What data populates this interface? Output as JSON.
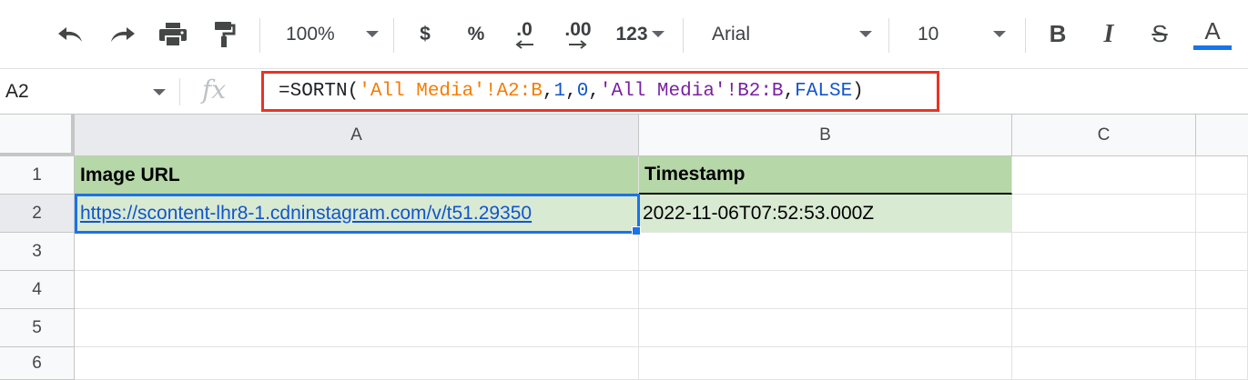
{
  "toolbar": {
    "zoom": "100%",
    "currency": "$",
    "percent": "%",
    "dec_decrease": ".0",
    "dec_increase": ".00",
    "more_formats": "123",
    "font": "Arial",
    "font_size": "10",
    "bold": "B",
    "italic": "I",
    "strike": "S",
    "text_color": "A",
    "text_color_swatch": "#1a73e8"
  },
  "formula_bar": {
    "name_box": "A2",
    "fx": "fx",
    "parts": [
      "=SORTN(",
      "'All Media'!A2:B",
      ",",
      "1",
      ",",
      "0",
      ",",
      "'All Media'!B2:B",
      ",",
      "FALSE",
      ")"
    ]
  },
  "grid": {
    "columns": [
      "A",
      "B",
      "C"
    ],
    "rows": [
      "1",
      "2",
      "3",
      "4",
      "5",
      "6"
    ],
    "cells": {
      "A1": "Image URL",
      "B1": "Timestamp",
      "A2": "https://scontent-lhr8-1.cdninstagram.com/v/t51.29350",
      "B2": "2022-11-06T07:52:53.000Z"
    },
    "selected": "A2"
  },
  "colors": {
    "header_fill": "#b6d7a8",
    "data_fill": "#d9ead3",
    "selection": "#1a73e8",
    "formula_highlight": "#ea3323",
    "link": "#1155cc"
  }
}
